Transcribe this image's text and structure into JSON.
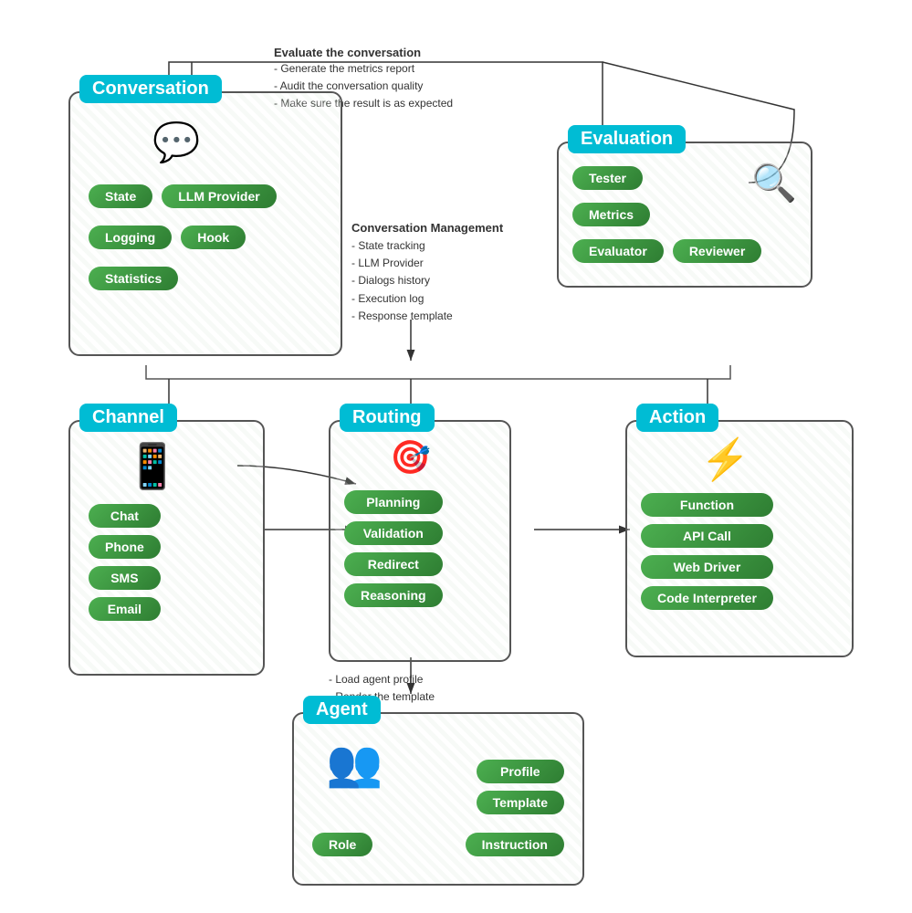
{
  "header": {
    "evaluate_title": "Evaluate the conversation",
    "evaluate_bullets": [
      "- Generate the metrics report",
      "- Audit the conversation quality",
      "- Make sure the result is as expected"
    ]
  },
  "conversation": {
    "title": "Conversation",
    "management_title": "Conversation Management",
    "management_bullets": [
      "- State tracking",
      "- LLM Provider",
      "- Dialogs history",
      "- Execution log",
      "- Response template"
    ],
    "pills": [
      "State",
      "LLM Provider",
      "Logging",
      "Hook",
      "Statistics"
    ]
  },
  "evaluation": {
    "title": "Evaluation",
    "pills": [
      "Tester",
      "Metrics",
      "Evaluator",
      "Reviewer"
    ]
  },
  "channel": {
    "title": "Channel",
    "pills": [
      "Chat",
      "Phone",
      "SMS",
      "Email"
    ]
  },
  "routing": {
    "title": "Routing",
    "pills": [
      "Planning",
      "Validation",
      "Redirect",
      "Reasoning"
    ],
    "agent_bullets": [
      "- Load agent profile",
      "- Render the template"
    ]
  },
  "action": {
    "title": "Action",
    "pills": [
      "Function",
      "API Call",
      "Web Driver",
      "Code Interpreter"
    ]
  },
  "agent": {
    "title": "Agent",
    "pills_left": [
      "Role"
    ],
    "pills_right": [
      "Profile",
      "Template",
      "Instruction"
    ]
  }
}
